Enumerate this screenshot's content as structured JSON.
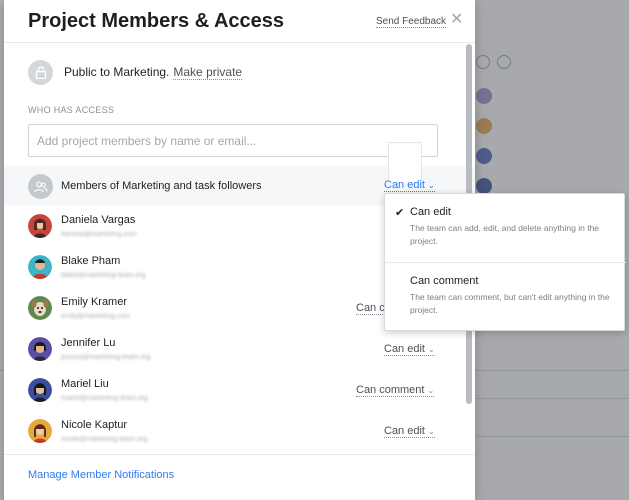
{
  "modal": {
    "title": "Project Members & Access",
    "send_feedback": "Send Feedback",
    "close_icon": "close-icon"
  },
  "privacy": {
    "icon": "lock-icon",
    "text": "Public to Marketing.",
    "action": "Make private"
  },
  "access": {
    "section_label": "WHO HAS ACCESS",
    "input_placeholder": "Add project members by name or email...",
    "team": {
      "icon": "team-icon",
      "label": "Members of Marketing and task followers",
      "permission": "Can edit"
    },
    "members": [
      {
        "name": "Daniela Vargas",
        "email": "",
        "permission": ""
      },
      {
        "name": "Blake Pham",
        "email": "",
        "permission": ""
      },
      {
        "name": "Emily Kramer",
        "email": "",
        "permission": "Can c"
      },
      {
        "name": "Jennifer Lu",
        "email": "",
        "permission": "Can edit"
      },
      {
        "name": "Mariel Liu",
        "email": "",
        "permission": "Can comment"
      },
      {
        "name": "Nicole Kaptur",
        "email": "",
        "permission": "Can edit"
      }
    ]
  },
  "footer": {
    "manage_link": "Manage Member Notifications"
  },
  "dropdown": {
    "options": [
      {
        "title": "Can edit",
        "description": "The team can add, edit, and delete anything in the project.",
        "selected": true
      },
      {
        "title": "Can comment",
        "description": "The team can comment, but can't edit anything in the project.",
        "selected": false
      }
    ]
  },
  "colors": {
    "accent": "#2d7cf5",
    "overlay": "#8e9194"
  }
}
